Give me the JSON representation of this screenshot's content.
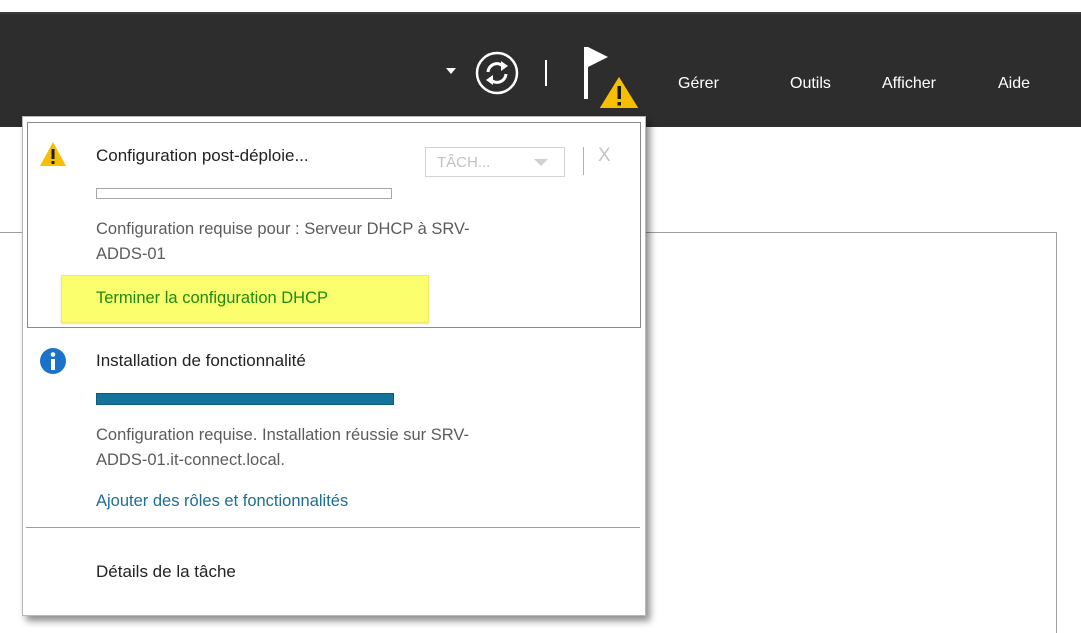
{
  "toolbar": {
    "menu": [
      "Gérer",
      "Outils",
      "Afficher",
      "Aide"
    ],
    "icons": [
      "dropdown-arrow-icon",
      "refresh-icon",
      "notification-flag-icon",
      "warning-icon"
    ]
  },
  "notifications": [
    {
      "type": "warning",
      "title": "Configuration post-déploie...",
      "task_button": "TÂCH...",
      "close": "X",
      "progress": 0,
      "description_line1": "Configuration requise pour : Serveur DHCP à SRV-",
      "description_line2": "ADDS-01",
      "action": "Terminer la configuration DHCP",
      "action_color": "#1f8a0f",
      "highlight_color": "#fbff6e"
    },
    {
      "type": "info",
      "title": "Installation de fonctionnalité",
      "progress": 1,
      "description_line1": "Configuration requise. Installation réussie sur SRV-",
      "description_line2": "ADDS-01.it-connect.local.",
      "action": "Ajouter des rôles et fonctionnalités",
      "action_color": "#1c6e92"
    }
  ],
  "footer": {
    "task_details": "Détails de la tâche"
  },
  "colors": {
    "toolbar_bg": "#2d2d2d",
    "progress_fill": "#13739b",
    "warning_yellow": "#f6c000",
    "info_blue": "#1a73c8"
  }
}
